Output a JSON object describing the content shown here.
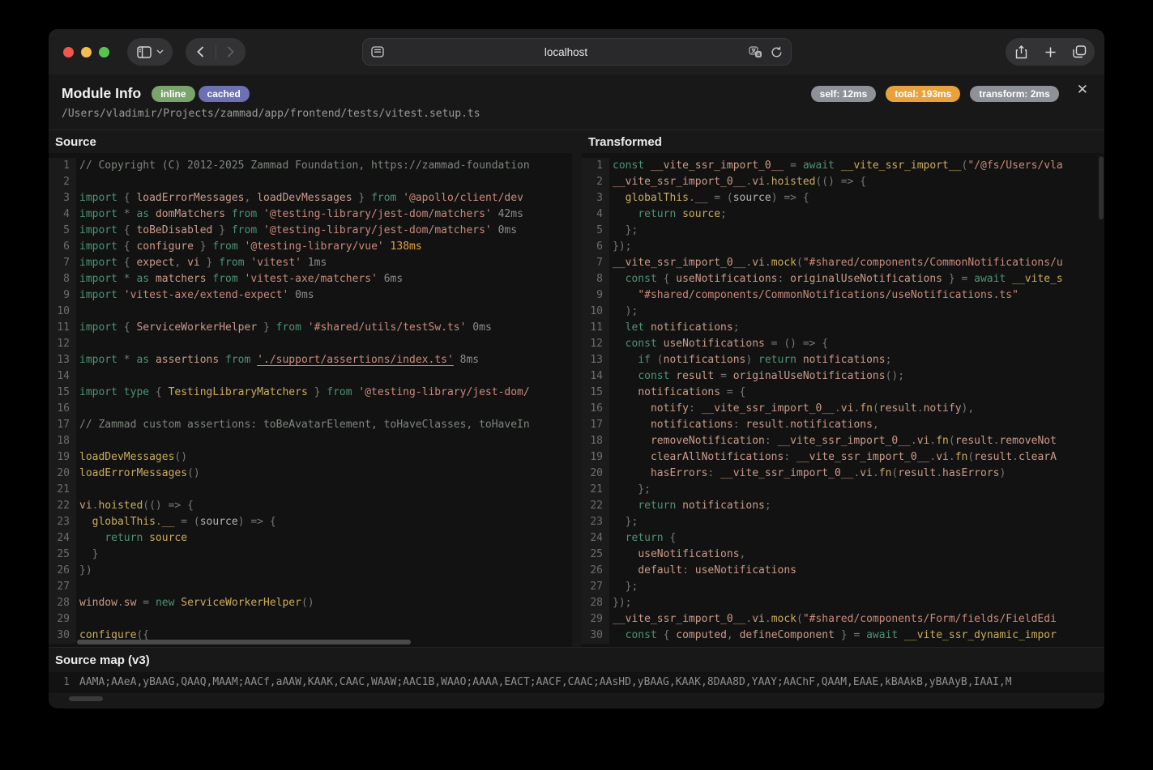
{
  "browser": {
    "url": "localhost",
    "icons": [
      "sidebar-toggle",
      "back",
      "forward",
      "page-settings",
      "translate",
      "reload",
      "share",
      "new-tab",
      "tab-overview"
    ]
  },
  "header": {
    "title": "Module Info",
    "badges": [
      {
        "label": "inline",
        "color": "#7aa46c"
      },
      {
        "label": "cached",
        "color": "#6b71b3"
      }
    ],
    "path": "/Users/vladimir/Projects/zammad/app/frontend/tests/vitest.setup.ts",
    "timings": [
      {
        "label": "self: 12ms",
        "color": "#8e9197"
      },
      {
        "label": "total: 193ms",
        "color": "#e9a23b"
      },
      {
        "label": "transform: 2ms",
        "color": "#8e9197"
      }
    ],
    "close_label": "✕"
  },
  "colors": {
    "keyword": "#4d9375",
    "identifier": "#cb9a8a",
    "string": "#c98a7d",
    "function": "#ccab5e",
    "comment": "#7e857e",
    "timing_orange": "#dfa344"
  },
  "panels": {
    "source": {
      "title": "Source",
      "lines": [
        [
          [
            "c",
            "// Copyright (C) 2012-2025 Zammad Foundation, https://zammad-foundation"
          ]
        ],
        [],
        [
          [
            "k",
            "import "
          ],
          [
            "p",
            "{ "
          ],
          [
            "i",
            "loadErrorMessages"
          ],
          [
            "p",
            ", "
          ],
          [
            "i",
            "loadDevMessages"
          ],
          [
            "p",
            " } "
          ],
          [
            "k",
            "from "
          ],
          [
            "s",
            "'@apollo/client/dev"
          ]
        ],
        [
          [
            "k",
            "import "
          ],
          [
            "p",
            "* "
          ],
          [
            "k",
            "as "
          ],
          [
            "i",
            "domMatchers "
          ],
          [
            "k",
            "from "
          ],
          [
            "s",
            "'@testing-library/jest-dom/matchers'"
          ],
          [
            "t",
            " 42ms"
          ]
        ],
        [
          [
            "k",
            "import "
          ],
          [
            "p",
            "{ "
          ],
          [
            "i",
            "toBeDisabled"
          ],
          [
            "p",
            " } "
          ],
          [
            "k",
            "from "
          ],
          [
            "s",
            "'@testing-library/jest-dom/matchers'"
          ],
          [
            "t",
            " 0ms"
          ]
        ],
        [
          [
            "k",
            "import "
          ],
          [
            "p",
            "{ "
          ],
          [
            "i",
            "configure"
          ],
          [
            "p",
            " } "
          ],
          [
            "k",
            "from "
          ],
          [
            "s",
            "'@testing-library/vue'"
          ],
          [
            "o",
            " 138ms"
          ]
        ],
        [
          [
            "k",
            "import "
          ],
          [
            "p",
            "{ "
          ],
          [
            "i",
            "expect"
          ],
          [
            "p",
            ", "
          ],
          [
            "i",
            "vi"
          ],
          [
            "p",
            " } "
          ],
          [
            "k",
            "from "
          ],
          [
            "s",
            "'vitest'"
          ],
          [
            "t",
            " 1ms"
          ]
        ],
        [
          [
            "k",
            "import "
          ],
          [
            "p",
            "* "
          ],
          [
            "k",
            "as "
          ],
          [
            "i",
            "matchers "
          ],
          [
            "k",
            "from "
          ],
          [
            "s",
            "'vitest-axe/matchers'"
          ],
          [
            "t",
            " 6ms"
          ]
        ],
        [
          [
            "k",
            "import "
          ],
          [
            "s",
            "'vitest-axe/extend-expect'"
          ],
          [
            "t",
            " 0ms"
          ]
        ],
        [],
        [
          [
            "k",
            "import "
          ],
          [
            "p",
            "{ "
          ],
          [
            "i",
            "ServiceWorkerHelper"
          ],
          [
            "p",
            " } "
          ],
          [
            "k",
            "from "
          ],
          [
            "s",
            "'#shared/utils/testSw.ts'"
          ],
          [
            "t",
            " 0ms"
          ]
        ],
        [],
        [
          [
            "k",
            "import "
          ],
          [
            "p",
            "* "
          ],
          [
            "k",
            "as "
          ],
          [
            "i",
            "assertions "
          ],
          [
            "k",
            "from "
          ],
          [
            "u",
            "'./support/assertions/index.ts'"
          ],
          [
            "t",
            " 8ms"
          ]
        ],
        [],
        [
          [
            "k",
            "import type "
          ],
          [
            "p",
            "{ "
          ],
          [
            "f",
            "TestingLibraryMatchers"
          ],
          [
            "p",
            " } "
          ],
          [
            "k",
            "from "
          ],
          [
            "s",
            "'@testing-library/jest-dom/"
          ]
        ],
        [],
        [
          [
            "c",
            "// Zammad custom assertions: toBeAvatarElement, toHaveClasses, toHaveIn"
          ]
        ],
        [],
        [
          [
            "f",
            "loadDevMessages"
          ],
          [
            "p",
            "()"
          ]
        ],
        [
          [
            "f",
            "loadErrorMessages"
          ],
          [
            "p",
            "()"
          ]
        ],
        [],
        [
          [
            "i",
            "vi"
          ],
          [
            "p",
            "."
          ],
          [
            "f",
            "hoisted"
          ],
          [
            "p",
            "(() => {"
          ]
        ],
        [
          [
            "p",
            "  "
          ],
          [
            "f",
            "globalThis"
          ],
          [
            "p",
            "."
          ],
          [
            "i",
            "__"
          ],
          [
            "p",
            " = ("
          ],
          [
            "d",
            "source"
          ],
          [
            "p",
            ") => {"
          ]
        ],
        [
          [
            "p",
            "    "
          ],
          [
            "k",
            "return "
          ],
          [
            "f",
            "source"
          ]
        ],
        [
          [
            "p",
            "  }"
          ]
        ],
        [
          [
            "p",
            "})"
          ]
        ],
        [],
        [
          [
            "i",
            "window"
          ],
          [
            "p",
            "."
          ],
          [
            "i",
            "sw"
          ],
          [
            "p",
            " = "
          ],
          [
            "k",
            "new "
          ],
          [
            "f",
            "ServiceWorkerHelper"
          ],
          [
            "p",
            "()"
          ]
        ],
        [],
        [
          [
            "f",
            "configure"
          ],
          [
            "p",
            "({"
          ]
        ]
      ]
    },
    "transformed": {
      "title": "Transformed",
      "lines": [
        [
          [
            "k",
            "const "
          ],
          [
            "i",
            "__vite_ssr_import_0__"
          ],
          [
            "p",
            " = "
          ],
          [
            "k",
            "await "
          ],
          [
            "f",
            "__vite_ssr_import__"
          ],
          [
            "p",
            "("
          ],
          [
            "s",
            "\"/@fs/Users/vla"
          ]
        ],
        [
          [
            "i",
            "__vite_ssr_import_0__"
          ],
          [
            "p",
            "."
          ],
          [
            "i",
            "vi"
          ],
          [
            "p",
            "."
          ],
          [
            "f",
            "hoisted"
          ],
          [
            "p",
            "(() => {"
          ]
        ],
        [
          [
            "p",
            "  "
          ],
          [
            "f",
            "globalThis"
          ],
          [
            "p",
            "."
          ],
          [
            "i",
            "__"
          ],
          [
            "p",
            " = ("
          ],
          [
            "d",
            "source"
          ],
          [
            "p",
            ") => {"
          ]
        ],
        [
          [
            "p",
            "    "
          ],
          [
            "k",
            "return "
          ],
          [
            "f",
            "source"
          ],
          [
            "p",
            ";"
          ]
        ],
        [
          [
            "p",
            "  };"
          ]
        ],
        [
          [
            "p",
            "});"
          ]
        ],
        [
          [
            "i",
            "__vite_ssr_import_0__"
          ],
          [
            "p",
            "."
          ],
          [
            "i",
            "vi"
          ],
          [
            "p",
            "."
          ],
          [
            "f",
            "mock"
          ],
          [
            "p",
            "("
          ],
          [
            "s",
            "\"#shared/components/CommonNotifications/u"
          ]
        ],
        [
          [
            "p",
            "  "
          ],
          [
            "k",
            "const "
          ],
          [
            "p",
            "{ "
          ],
          [
            "i",
            "useNotifications"
          ],
          [
            "p",
            ": "
          ],
          [
            "i",
            "originalUseNotifications"
          ],
          [
            "p",
            " } = "
          ],
          [
            "k",
            "await "
          ],
          [
            "f",
            "__vite_s"
          ]
        ],
        [
          [
            "p",
            "    "
          ],
          [
            "s",
            "\"#shared/components/CommonNotifications/useNotifications.ts\""
          ]
        ],
        [
          [
            "p",
            "  );"
          ]
        ],
        [
          [
            "p",
            "  "
          ],
          [
            "k",
            "let "
          ],
          [
            "i",
            "notifications"
          ],
          [
            "p",
            ";"
          ]
        ],
        [
          [
            "p",
            "  "
          ],
          [
            "k",
            "const "
          ],
          [
            "i",
            "useNotifications"
          ],
          [
            "p",
            " = () => {"
          ]
        ],
        [
          [
            "p",
            "    "
          ],
          [
            "k",
            "if "
          ],
          [
            "p",
            "("
          ],
          [
            "i",
            "notifications"
          ],
          [
            "p",
            ") "
          ],
          [
            "k",
            "return "
          ],
          [
            "i",
            "notifications"
          ],
          [
            "p",
            ";"
          ]
        ],
        [
          [
            "p",
            "    "
          ],
          [
            "k",
            "const "
          ],
          [
            "i",
            "result"
          ],
          [
            "p",
            " = "
          ],
          [
            "i",
            "originalUseNotifications"
          ],
          [
            "p",
            "();"
          ]
        ],
        [
          [
            "p",
            "    "
          ],
          [
            "i",
            "notifications"
          ],
          [
            "p",
            " = {"
          ]
        ],
        [
          [
            "p",
            "      "
          ],
          [
            "i",
            "notify"
          ],
          [
            "p",
            ": "
          ],
          [
            "i",
            "__vite_ssr_import_0__"
          ],
          [
            "p",
            "."
          ],
          [
            "i",
            "vi"
          ],
          [
            "p",
            "."
          ],
          [
            "f",
            "fn"
          ],
          [
            "p",
            "("
          ],
          [
            "i",
            "result"
          ],
          [
            "p",
            "."
          ],
          [
            "i",
            "notify"
          ],
          [
            "p",
            "),"
          ]
        ],
        [
          [
            "p",
            "      "
          ],
          [
            "i",
            "notifications"
          ],
          [
            "p",
            ": "
          ],
          [
            "i",
            "result"
          ],
          [
            "p",
            "."
          ],
          [
            "i",
            "notifications"
          ],
          [
            "p",
            ","
          ]
        ],
        [
          [
            "p",
            "      "
          ],
          [
            "i",
            "removeNotification"
          ],
          [
            "p",
            ": "
          ],
          [
            "i",
            "__vite_ssr_import_0__"
          ],
          [
            "p",
            "."
          ],
          [
            "i",
            "vi"
          ],
          [
            "p",
            "."
          ],
          [
            "f",
            "fn"
          ],
          [
            "p",
            "("
          ],
          [
            "i",
            "result"
          ],
          [
            "p",
            "."
          ],
          [
            "i",
            "removeNot"
          ]
        ],
        [
          [
            "p",
            "      "
          ],
          [
            "i",
            "clearAllNotifications"
          ],
          [
            "p",
            ": "
          ],
          [
            "i",
            "__vite_ssr_import_0__"
          ],
          [
            "p",
            "."
          ],
          [
            "i",
            "vi"
          ],
          [
            "p",
            "."
          ],
          [
            "f",
            "fn"
          ],
          [
            "p",
            "("
          ],
          [
            "i",
            "result"
          ],
          [
            "p",
            "."
          ],
          [
            "i",
            "clearA"
          ]
        ],
        [
          [
            "p",
            "      "
          ],
          [
            "i",
            "hasErrors"
          ],
          [
            "p",
            ": "
          ],
          [
            "i",
            "__vite_ssr_import_0__"
          ],
          [
            "p",
            "."
          ],
          [
            "i",
            "vi"
          ],
          [
            "p",
            "."
          ],
          [
            "f",
            "fn"
          ],
          [
            "p",
            "("
          ],
          [
            "i",
            "result"
          ],
          [
            "p",
            "."
          ],
          [
            "i",
            "hasErrors"
          ],
          [
            "p",
            ")"
          ]
        ],
        [
          [
            "p",
            "    };"
          ]
        ],
        [
          [
            "p",
            "    "
          ],
          [
            "k",
            "return "
          ],
          [
            "i",
            "notifications"
          ],
          [
            "p",
            ";"
          ]
        ],
        [
          [
            "p",
            "  };"
          ]
        ],
        [
          [
            "p",
            "  "
          ],
          [
            "k",
            "return "
          ],
          [
            "p",
            "{"
          ]
        ],
        [
          [
            "p",
            "    "
          ],
          [
            "i",
            "useNotifications"
          ],
          [
            "p",
            ","
          ]
        ],
        [
          [
            "p",
            "    "
          ],
          [
            "i",
            "default"
          ],
          [
            "p",
            ": "
          ],
          [
            "i",
            "useNotifications"
          ]
        ],
        [
          [
            "p",
            "  };"
          ]
        ],
        [
          [
            "p",
            "});"
          ]
        ],
        [
          [
            "i",
            "__vite_ssr_import_0__"
          ],
          [
            "p",
            "."
          ],
          [
            "i",
            "vi"
          ],
          [
            "p",
            "."
          ],
          [
            "f",
            "mock"
          ],
          [
            "p",
            "("
          ],
          [
            "s",
            "\"#shared/components/Form/fields/FieldEdi"
          ]
        ],
        [
          [
            "p",
            "  "
          ],
          [
            "k",
            "const "
          ],
          [
            "p",
            "{ "
          ],
          [
            "i",
            "computed"
          ],
          [
            "p",
            ", "
          ],
          [
            "i",
            "defineComponent"
          ],
          [
            "p",
            " } = "
          ],
          [
            "k",
            "await "
          ],
          [
            "f",
            "__vite_ssr_dynamic_impor"
          ]
        ]
      ]
    }
  },
  "sourcemap": {
    "title": "Source map (v3)",
    "line_number": "1",
    "mappings": "AAMA;AAeA,yBAAG,QAAQ,MAAM;AACf,aAAW,KAAK,CAAC,WAAW;AAC1B,WAAO;AAAA,EACT;AACF,CAAC;AAsHD,yBAAG,KAAK,8DAA8D,YAAY;AAChF,QAAM,EAAE,kBAAkB,yBAAyB,IAAI,M"
  }
}
